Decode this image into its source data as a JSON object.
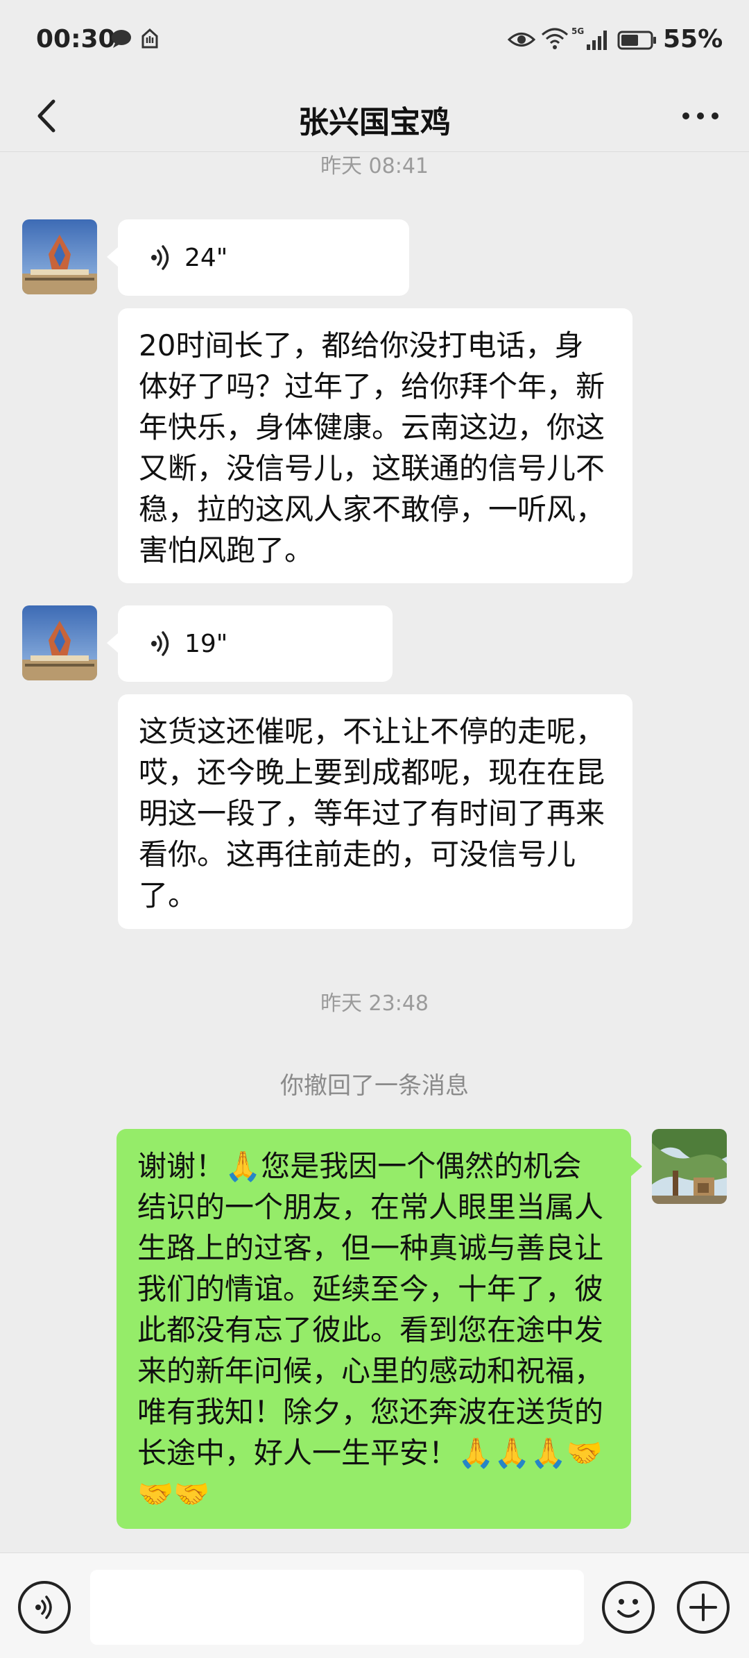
{
  "status_bar": {
    "time": "00:30",
    "network": "5G",
    "battery": "55%"
  },
  "header": {
    "title": "张兴国宝鸡"
  },
  "messages": {
    "ts1": "昨天 08:41",
    "voice1": "24\"",
    "text1": "20时间长了，都给你没打电话，身体好了吗？过年了，给你拜个年，新年快乐，身体健康。云南这边，你这又断，没信号儿，这联通的信号儿不稳，拉的这风人家不敢停，一听风，害怕风跑了。",
    "voice2": "19\"",
    "text2": "这货这还催呢，不让让不停的走呢，哎，还今晚上要到成都呢，现在在昆明这一段了，等年过了有时间了再来看你。这再往前走的，可没信号儿了。",
    "ts2": "昨天 23:48",
    "recall": "你撤回了一条消息",
    "my_text": "谢谢！🙏您是我因一个偶然的机会结识的一个朋友，在常人眼里当属人生路上的过客，但一种真诚与善良让我们的情谊。延续至今，十年了，彼此都没有忘了彼此。看到您在途中发来的新年问候，心里的感动和祝福，唯有我知！除夕，您还奔波在送货的长途中，好人一生平安！🙏🙏🙏🤝🤝🤝"
  },
  "colors": {
    "background": "#ededed",
    "my_bubble": "#95ec69",
    "other_bubble": "#ffffff",
    "timestamp_text": "#9b9b9b"
  },
  "icons": {
    "back": "chevron-left-icon",
    "more": "more-dots-icon",
    "voice": "voice-wave-icon",
    "emoji": "smiley-icon",
    "plus": "plus-icon"
  }
}
